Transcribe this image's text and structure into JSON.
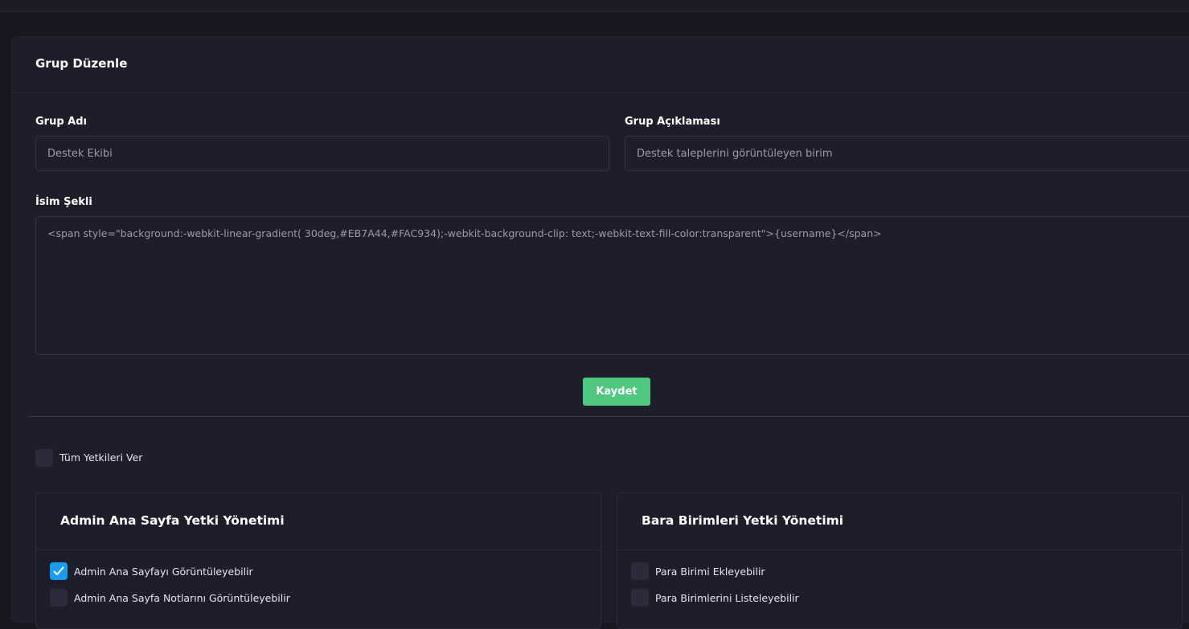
{
  "form": {
    "title": "Grup Düzenle",
    "group_name_label": "Grup Adı",
    "group_name_value": "Destek Ekibi",
    "group_desc_label": "Grup Açıklaması",
    "group_desc_value": "Destek taleplerini görüntüleyen birim",
    "name_style_label": "İsim Şekli",
    "name_style_value": "<span style=\"background:-webkit-linear-gradient( 30deg,#EB7A44,#FAC934);-webkit-background-clip: text;-webkit-text-fill-color:transparent\">{username}</span>",
    "save_label": "Kaydet"
  },
  "permissions": {
    "all_label": "Tüm Yetkileri Ver",
    "all_checked": false,
    "groups": [
      {
        "title": "Admin Ana Sayfa Yetki Yönetimi",
        "items": [
          {
            "label": "Admin Ana Sayfayı Görüntüleyebilir",
            "checked": true
          },
          {
            "label": "Admin Ana Sayfa Notlarını Görüntüleyebilir",
            "checked": false
          }
        ]
      },
      {
        "title": "Bara Birimleri Yetki Yönetimi",
        "items": [
          {
            "label": "Para Birimi Ekleyebilir",
            "checked": false
          },
          {
            "label": "Para Birimlerini Listeleyebilir",
            "checked": false
          }
        ]
      }
    ]
  },
  "colors": {
    "background": "#17171f",
    "card": "#1e1e2b",
    "accent_green": "#4fc87f",
    "checkbox_checked": "#1b9cf0"
  },
  "icons": {
    "checkmark": "check-icon"
  }
}
